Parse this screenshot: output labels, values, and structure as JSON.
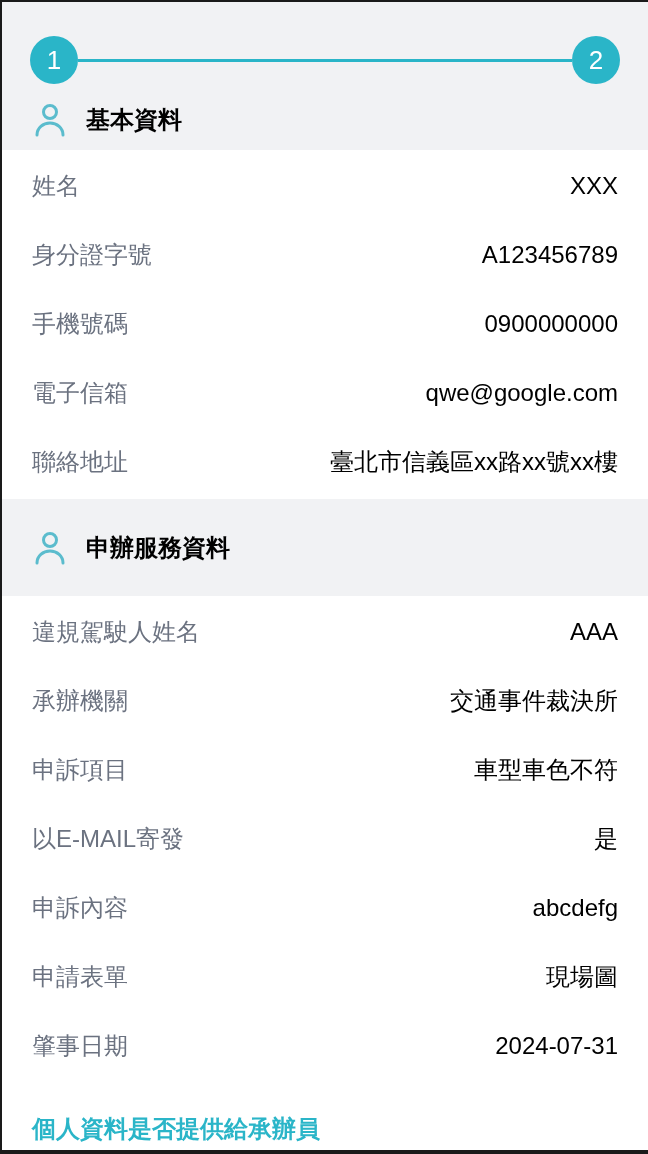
{
  "steps": [
    {
      "label": "1",
      "active": true
    },
    {
      "label": "2",
      "active": true
    }
  ],
  "sections": [
    {
      "title": "基本資料",
      "fields": [
        {
          "label": "姓名",
          "value": "XXX"
        },
        {
          "label": "身分證字號",
          "value": "A123456789"
        },
        {
          "label": "手機號碼",
          "value": "0900000000"
        },
        {
          "label": "電子信箱",
          "value": "qwe@google.com"
        },
        {
          "label": "聯絡地址",
          "value": "臺北市信義區xx路xx號xx樓"
        }
      ]
    },
    {
      "title": "申辦服務資料",
      "fields": [
        {
          "label": "違規駕駛人姓名",
          "value": "AAA"
        },
        {
          "label": "承辦機關",
          "value": "交通事件裁決所"
        },
        {
          "label": "申訴項目",
          "value": "車型車色不符"
        },
        {
          "label": "以E-MAIL寄發",
          "value": "是"
        },
        {
          "label": "申訴內容",
          "value": "abcdefg"
        },
        {
          "label": "申請表單",
          "value": "現場圖"
        },
        {
          "label": "肇事日期",
          "value": "2024-07-31"
        }
      ]
    }
  ],
  "question": "個人資料是否提供給承辦員"
}
